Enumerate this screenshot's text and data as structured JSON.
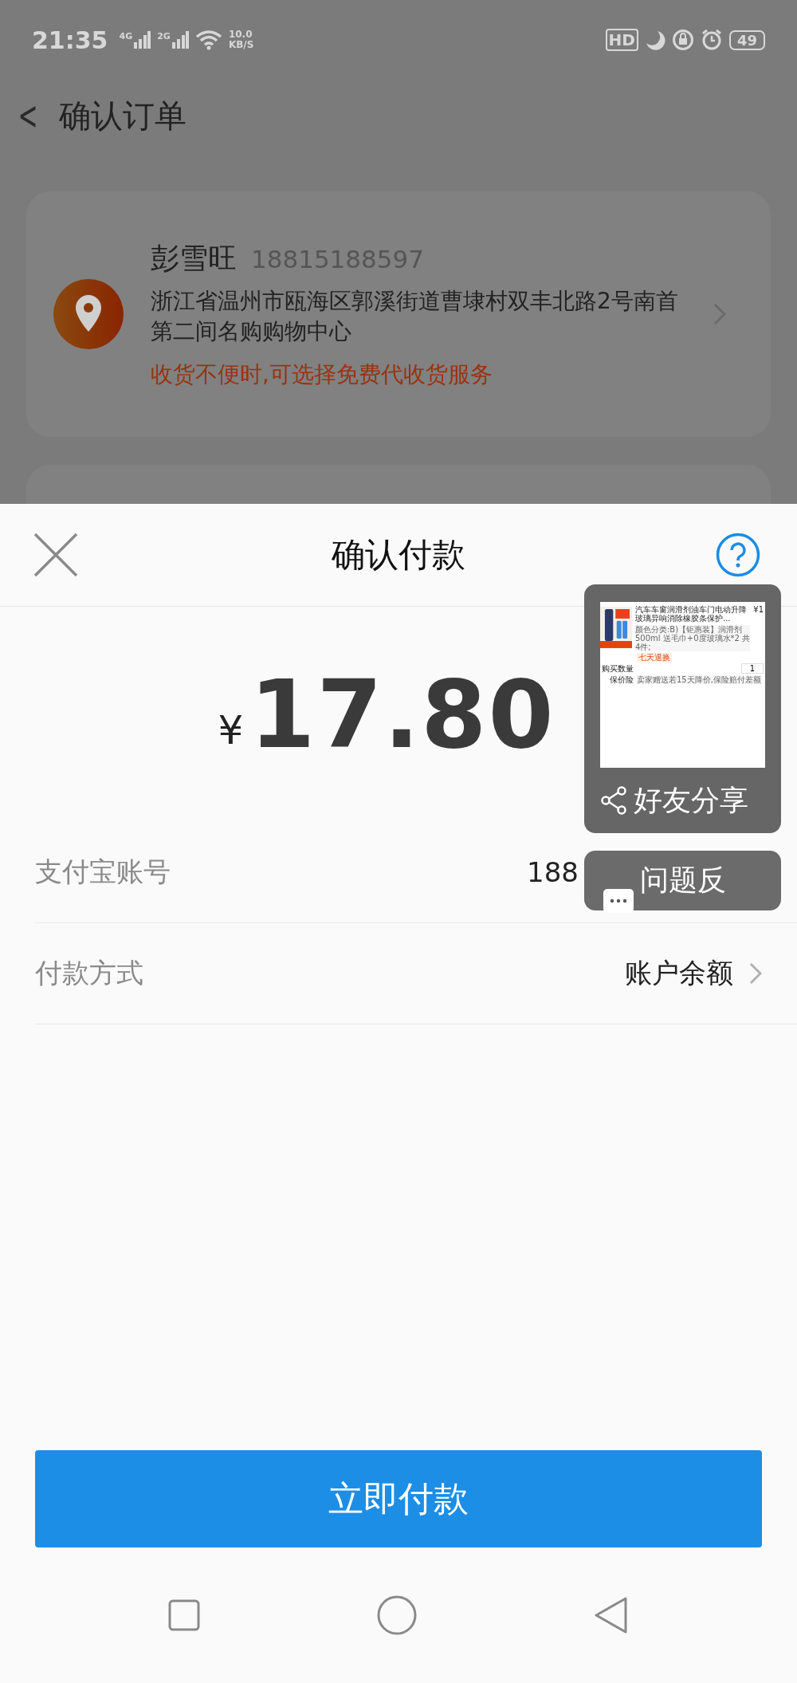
{
  "status_bar": {
    "time": "21:35",
    "network_1": "4G",
    "network_2": "2G",
    "speed_value": "10.0",
    "speed_unit": "KB/S",
    "hd": "HD",
    "battery": "49"
  },
  "header": {
    "back": "<",
    "title": "确认订单"
  },
  "address": {
    "name": "彭雪旺",
    "phone": "18815188597",
    "address": "浙江省温州市瓯海区郭溪街道曹埭村双丰北路2号南首第二间名购购物中心",
    "notice": "收货不便时,可选择免费代收货服务"
  },
  "payment_sheet": {
    "title": "确认付款",
    "currency": "¥",
    "amount": "17.80",
    "rows": [
      {
        "label": "支付宝账号",
        "value": "188",
        "has_chevron": false
      },
      {
        "label": "付款方式",
        "value": "账户余额",
        "has_chevron": true
      }
    ],
    "pay_button": "立即付款"
  },
  "share_widget": {
    "preview": {
      "title": "汽车车窗润滑剂油车门电动升降玻璃异响消除橡胶条保护...",
      "price": "¥1",
      "sku": "颜色分类:B)【钜惠装】润滑剂500ml 送毛巾+0度玻璃水*2 共4件;",
      "tag": "七天退换",
      "quantity_label": "购买数量",
      "quantity": "1",
      "insurance_label": "保价险",
      "insurance": "卖家赠送若15天降价,保险赔付差额"
    },
    "share_label": "好友分享",
    "feedback_label": "问题反"
  }
}
